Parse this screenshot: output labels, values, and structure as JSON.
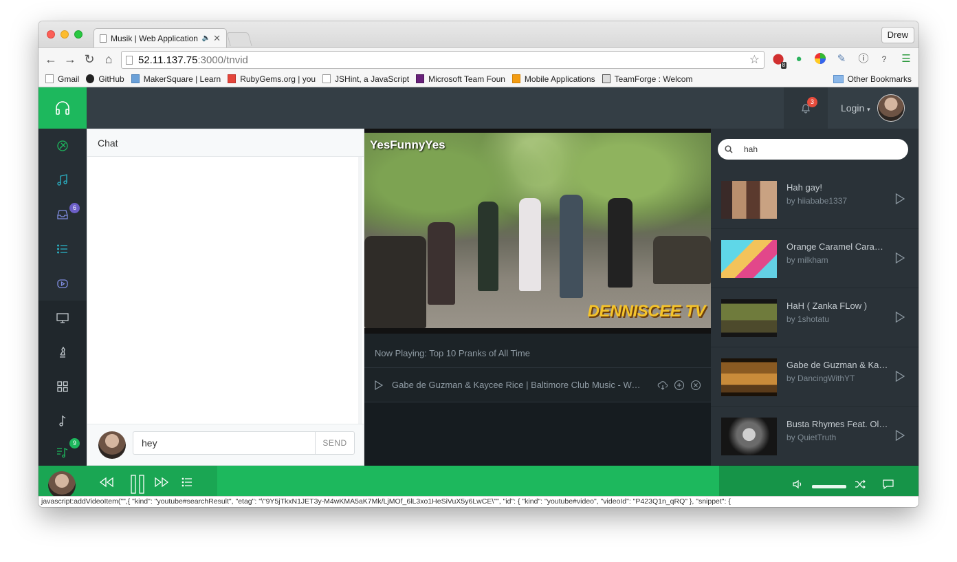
{
  "browser": {
    "tab_title": "Musik | Web Application",
    "user_button": "Drew",
    "url_host": "52.11.137.75",
    "url_path": ":3000/tnvid",
    "extension_badge": "8",
    "bookmarks": [
      {
        "label": "Gmail",
        "icon": "page-icon"
      },
      {
        "label": "GitHub",
        "icon": "github-icon"
      },
      {
        "label": "MakerSquare | Learn",
        "icon": "makersquare-icon"
      },
      {
        "label": "RubyGems.org | you",
        "icon": "rubygems-icon"
      },
      {
        "label": "JSHint, a JavaScript",
        "icon": "page-icon"
      },
      {
        "label": "Microsoft Team Foun",
        "icon": "visual-studio-icon"
      },
      {
        "label": "Mobile Applications",
        "icon": "apps-icon"
      },
      {
        "label": "TeamForge : Welcom",
        "icon": "teamforge-icon"
      }
    ],
    "other_bookmarks": "Other Bookmarks",
    "status_text": "javascript:addVideoItem(\"\",{   \"kind\": \"youtube#searchResult\",   \"etag\": \"\\\"9Y5jTkxN1JET3y-M4wKMA5aK7Mk/LjMOf_6lL3xo1HeSiVuX5y6LwCE\\\"\",   \"id\": {     \"kind\": \"youtube#video\",     \"videoId\": \"P423Q1n_qRQ\"   },   \"snippet\": {"
  },
  "app": {
    "notification_count": "3",
    "login_label": "Login",
    "sidebar": {
      "inbox_badge": "6",
      "queue_badge": "9"
    },
    "chat": {
      "title": "Chat",
      "input_value": "hey",
      "send_label": "SEND"
    },
    "video": {
      "brand_top": "YesFunnyYes",
      "brand_bottom": "DENNISCEE TV"
    },
    "now_playing": "Now Playing: Top 10 Pranks of All Time",
    "playlist": [
      {
        "title": "Gabe de Guzman & Kaycee Rice | Baltimore Club Music - Woo Woo Ha | Filmed..."
      }
    ],
    "search": {
      "query": "hah"
    },
    "results": [
      {
        "title": "Hah gay!",
        "by": "by hiiababe1337"
      },
      {
        "title": "Orange Caramel Caramel Catalog",
        "by": "by milkham"
      },
      {
        "title": "HaH ( Zanka FLow )",
        "by": "by 1shotatu"
      },
      {
        "title": "Gabe de Guzman & Kaycee Rice",
        "by": "by DancingWithYT"
      },
      {
        "title": "Busta Rhymes Feat. Ol' Dirty Bastard",
        "by": "by QuietTruth"
      }
    ],
    "colors": {
      "brand_green": "#1db85d",
      "topbar": "#343e45",
      "sidebar": "#20272c",
      "badge_red": "#e74c3c",
      "badge_purple": "#6c5fc7",
      "badge_green": "#1db85d"
    }
  }
}
